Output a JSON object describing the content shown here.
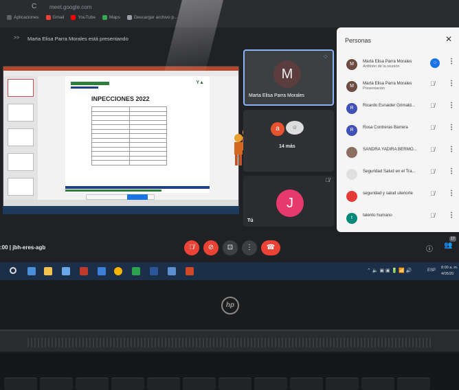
{
  "browser": {
    "url": "meet.google.com",
    "bookmarks": [
      {
        "label": "Aplicaciones",
        "icon": "apps-icon",
        "color": "#5f6368"
      },
      {
        "label": "Gmail",
        "icon": "gmail-icon",
        "color": "#ea4335"
      },
      {
        "label": "YouTube",
        "icon": "youtube-icon",
        "color": "#ff0000"
      },
      {
        "label": "Maps",
        "icon": "maps-icon",
        "color": "#34a853"
      },
      {
        "label": "Descargar archivo p...",
        "icon": "download-icon",
        "color": "#9aa0a6"
      }
    ]
  },
  "meeting": {
    "presenting_text": "Marta Elisa Parra Morales está presentando",
    "code_label": ":00  |  jbh-eres-agb"
  },
  "slide": {
    "title": "INPECCIONES 2022"
  },
  "tiles": {
    "main": {
      "initial": "M",
      "name": "Marta Elisa Parra Morales",
      "color": "#5b3d3d"
    },
    "more": {
      "initial": "a",
      "label": "14 más"
    },
    "self": {
      "initial": "J",
      "label": "Tú",
      "color": "#e8396c"
    }
  },
  "people_panel": {
    "title": "Personas",
    "people": [
      {
        "initial": "M",
        "name": "Marta Elisa Parra Morales",
        "sub": "Anfitrión de la reunión",
        "color": "#6d4c41",
        "mic": "speaking"
      },
      {
        "initial": "M",
        "name": "Marta Elisa Parra Morales",
        "sub": "Presentación",
        "color": "#6d4c41",
        "mic": "muted"
      },
      {
        "initial": "R",
        "name": "Ricardo Esnaider Grimald...",
        "sub": "",
        "color": "#3f51b5",
        "mic": "muted"
      },
      {
        "initial": "R",
        "name": "Rosa Contreras Barrera",
        "sub": "",
        "color": "#3f51b5",
        "mic": "muted"
      },
      {
        "initial": "",
        "name": "SANDRA YADIRA BERMO...",
        "sub": "",
        "color": "#8d6e63",
        "mic": "muted"
      },
      {
        "initial": "",
        "name": "Seguridad Salud en el Tra...",
        "sub": "",
        "color": "#e0e0e0",
        "mic": "muted"
      },
      {
        "initial": "",
        "name": "seguridad y salud utenorte",
        "sub": "",
        "color": "#e53935",
        "mic": "muted"
      },
      {
        "initial": "t",
        "name": "talento humano",
        "sub": "",
        "color": "#00897b",
        "mic": "muted"
      }
    ]
  },
  "controls": {
    "people_count": "17"
  },
  "taskbar": {
    "lang": "ESP",
    "time": "8:00 a. m.",
    "date": "4/05/20"
  },
  "laptop": {
    "logo": "hp"
  }
}
